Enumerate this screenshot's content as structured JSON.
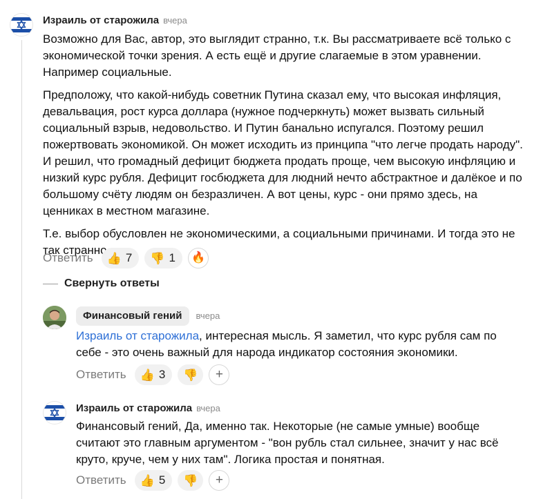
{
  "main_comment": {
    "author": "Израиль от старожила",
    "time": "вчера",
    "paragraphs": [
      "Возможно для Вас, автор, это выглядит странно, т.к. Вы рассматриваете всё только с экономической точки зрения. А есть ещё и другие слагаемые в этом уравнении. Например социальные.",
      "Предположу, что какой-нибудь советник Путина сказал ему, что высокая инфляция, девальвация, рост курса доллара (нужное подчеркнуть) может вызвать сильный социальный взрыв, недовольство. И Путин банально испугался. Поэтому решил пожертвовать экономикой. Он может исходить из принципа \"что легче продать народу\". И решил, что громадный дефицит бюджета продать проще, чем высокую инфляцию и низкий курс рубля. Дефицит госбюджета для людний нечто абстрактное и далёкое и по большому счёту людям он безразличен. А вот цены, курс - они прямо здесь, на ценниках в местном магазине.",
      "Т.е. выбор обусловлен не экономическими, а социальными причинами. И тогда это не так странно."
    ],
    "reply_label": "Ответить",
    "likes": "7",
    "dislikes": "1",
    "like_icon": "thumbs-up-icon",
    "dislike_icon": "thumbs-down-icon"
  },
  "collapse_label": "Свернуть ответы",
  "replies": [
    {
      "author": "Финансовый гений",
      "time": "вчера",
      "mention": "Израиль от старожила",
      "text": ", интересная мысль. Я заметил, что курс рубля сам по себе - это очень важный для народа индикатор состояния экономики.",
      "reply_label": "Ответить",
      "likes": "3",
      "add_label": "+"
    },
    {
      "author": "Израиль от старожила",
      "time": "вчера",
      "text": "Финансовый гений, Да, именно так. Некоторые (не самые умные) вообще считают это главным аргументом - \"вон рубль стал сильнее, значит у нас всё круто, круче, чем у них там\". Логика простая и понятная.",
      "reply_label": "Ответить",
      "likes": "5",
      "add_label": "+"
    }
  ],
  "colors": {
    "flag_blue": "#1c4fa8",
    "mention": "#2d6fd6",
    "pill_bg": "#f1f1f1"
  }
}
